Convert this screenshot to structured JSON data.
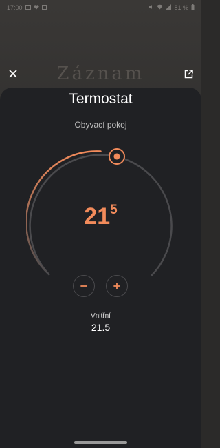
{
  "status_bar": {
    "time": "17:00",
    "battery": "81 %",
    "left_icons": [
      "image-icon",
      "heart-icon",
      "box-icon"
    ],
    "right_icons": [
      "mute-icon",
      "wifi-icon",
      "signal-icon",
      "battery-icon"
    ]
  },
  "background": {
    "title": "Záznam"
  },
  "top_actions": {
    "close_icon": "close-icon",
    "open_icon": "open-in-new-icon"
  },
  "thermostat": {
    "title": "Termostat",
    "room": "Obyvací pokoj",
    "temp_integer": "21",
    "temp_fraction": "5",
    "minus_label": "−",
    "plus_label": "+",
    "inner_label": "Vnitřní",
    "inner_value": "21.5",
    "setpoint_level": 0.5
  },
  "colors": {
    "accent": "#f28b5b",
    "sheet": "#202124",
    "track": "#4a4a4d"
  }
}
